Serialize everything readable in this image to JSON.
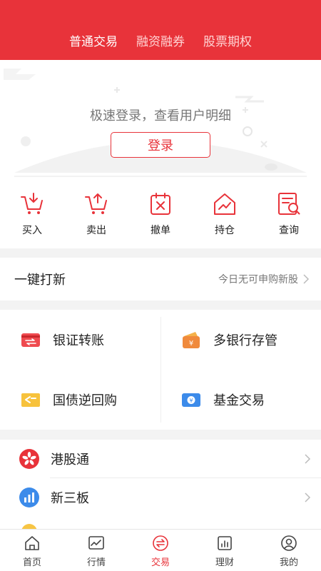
{
  "header": {
    "tabs": [
      {
        "label": "普通交易",
        "active": true
      },
      {
        "label": "融资融券",
        "active": false
      },
      {
        "label": "股票期权",
        "active": false
      }
    ]
  },
  "hero": {
    "message": "极速登录，查看用户明细",
    "login_label": "登录"
  },
  "quick_actions": [
    {
      "label": "买入",
      "icon": "cart-in-icon"
    },
    {
      "label": "卖出",
      "icon": "cart-out-icon"
    },
    {
      "label": "撤单",
      "icon": "cancel-order-icon"
    },
    {
      "label": "持仓",
      "icon": "holdings-icon"
    },
    {
      "label": "查询",
      "icon": "query-icon"
    }
  ],
  "ipo": {
    "title": "一键打新",
    "status": "今日无可申购新股"
  },
  "services": [
    {
      "label": "银证转账",
      "icon": "transfer-icon"
    },
    {
      "label": "多银行存管",
      "icon": "wallet-icon"
    },
    {
      "label": "国债逆回购",
      "icon": "repo-icon"
    },
    {
      "label": "基金交易",
      "icon": "fund-icon"
    }
  ],
  "list": [
    {
      "label": "港股通",
      "icon": "hk-connect-icon"
    },
    {
      "label": "新三板",
      "icon": "neeq-icon"
    }
  ],
  "tabbar": [
    {
      "label": "首页",
      "icon": "home-icon",
      "active": false
    },
    {
      "label": "行情",
      "icon": "market-icon",
      "active": false
    },
    {
      "label": "交易",
      "icon": "trade-icon",
      "active": true
    },
    {
      "label": "理财",
      "icon": "wealth-icon",
      "active": false
    },
    {
      "label": "我的",
      "icon": "profile-icon",
      "active": false
    }
  ],
  "colors": {
    "accent": "#e8333a",
    "background": "#f3f3f3"
  }
}
